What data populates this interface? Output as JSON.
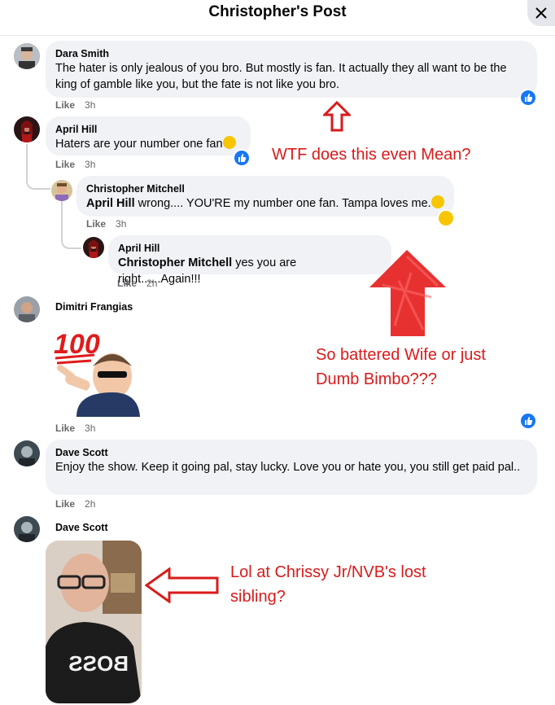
{
  "header": {
    "title": "Christopher's Post",
    "close_icon": "close-icon"
  },
  "comments": [
    {
      "name": "Dara Smith",
      "text": "The hater is only jealous of you bro. But mostly is fan. It actually they all want to be the king of gamble like you, but the fate is not like you bro.",
      "like": "Like",
      "time": "3h"
    },
    {
      "name": "April Hill",
      "text": "Haters are your number one fan",
      "like": "Like",
      "time": "3h"
    },
    {
      "name": "Christopher Mitchell",
      "mention": "April Hill",
      "text": " wrong.... YOU'RE my number one fan. Tampa loves me.",
      "like": "Like",
      "time": "3h"
    },
    {
      "name": "April Hill",
      "mention": "Christopher Mitchell",
      "text": " yes you are right......Again!!!",
      "like": "Like",
      "time": "2h"
    },
    {
      "name": "Dimitri Frangias",
      "sticker_text": "100",
      "like": "Like",
      "time": "3h"
    },
    {
      "name": "Dave Scott",
      "text": "Enjoy the show. Keep it going pal, stay lucky. Love you or hate you, you still get paid pal..",
      "like": "Like",
      "time": "2h"
    },
    {
      "name": "Dave Scott",
      "photo_text": "BOSS"
    }
  ],
  "annotations": [
    "WTF does this even Mean?",
    "So battered Wife or just Dumb Bimbo???",
    "Lol at Chrissy Jr/NVB's lost sibling?"
  ],
  "colors": {
    "accent": "#1877f2",
    "bubble": "#f0f2f5",
    "annotation": "#d81b1b"
  }
}
